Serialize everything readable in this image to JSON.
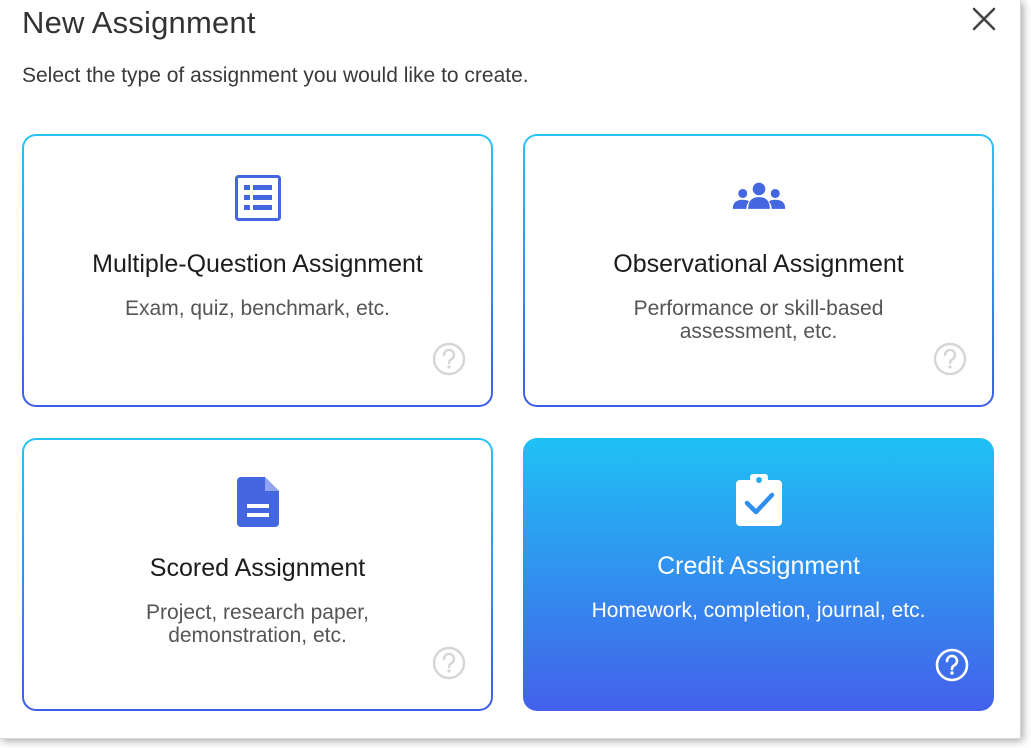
{
  "dialog": {
    "title": "New Assignment",
    "subtitle": "Select the type of assignment you would like to create.",
    "close_icon": "close-icon"
  },
  "colors": {
    "accent_top": "#1fc1f5",
    "accent_bottom": "#4460ea",
    "icon_blue": "#4466e0",
    "help_gray": "#d6d6d6"
  },
  "cards": [
    {
      "title": "Multiple-Question Assignment",
      "description": "Exam, quiz, benchmark, etc.",
      "icon": "list-icon",
      "selected": false
    },
    {
      "title": "Observational Assignment",
      "description": "Performance or skill-based assessment, etc.",
      "icon": "group-icon",
      "selected": false
    },
    {
      "title": "Scored Assignment",
      "description": "Project, research paper, demonstration, etc.",
      "icon": "document-icon",
      "selected": false
    },
    {
      "title": "Credit Assignment",
      "description": "Homework, completion, journal, etc.",
      "icon": "clipboard-check-icon",
      "selected": true
    }
  ]
}
